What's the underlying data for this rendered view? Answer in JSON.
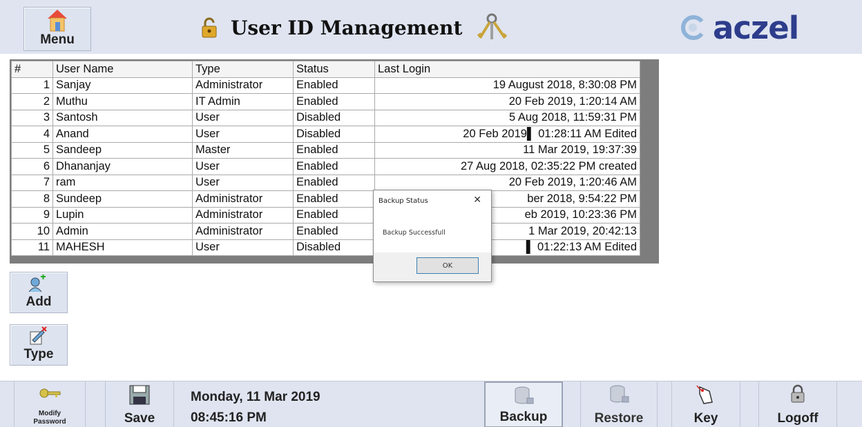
{
  "header": {
    "menu_label": "Menu",
    "title": "User ID Management",
    "brand": "aczel"
  },
  "grid": {
    "columns": [
      "#",
      "User Name",
      "Type",
      "Status",
      "Last Login"
    ],
    "rows": [
      {
        "num": "1",
        "name": "Sanjay",
        "type": "Administrator",
        "status": "Enabled",
        "last": "19 August 2018, 8:30:08 PM"
      },
      {
        "num": "2",
        "name": "Muthu",
        "type": "IT Admin",
        "status": "Enabled",
        "last": "20 Feb 2019, 1:20:14 AM"
      },
      {
        "num": "3",
        "name": "Santosh",
        "type": "User",
        "status": "Disabled",
        "last": "5 Aug 2018, 11:59:31 PM"
      },
      {
        "num": "4",
        "name": "Anand",
        "type": "User",
        "status": "Disabled",
        "last": "20 Feb 2019▌ 01:28:11 AM Edited"
      },
      {
        "num": "5",
        "name": "Sandeep",
        "type": "Master",
        "status": "Enabled",
        "last": "11 Mar 2019, 19:37:39"
      },
      {
        "num": "6",
        "name": "Dhananjay",
        "type": "User",
        "status": "Enabled",
        "last": "27 Aug 2018, 02:35:22 PM created"
      },
      {
        "num": "7",
        "name": "ram",
        "type": "User",
        "status": "Enabled",
        "last": "20 Feb 2019, 1:20:46 AM"
      },
      {
        "num": "8",
        "name": "Sundeep",
        "type": "Administrator",
        "status": "Enabled",
        "last": "ber 2018, 9:54:22 PM"
      },
      {
        "num": "9",
        "name": "Lupin",
        "type": "Administrator",
        "status": "Enabled",
        "last": "eb 2019, 10:23:36 PM"
      },
      {
        "num": "10",
        "name": "Admin",
        "type": "Administrator",
        "status": "Enabled",
        "last": "1 Mar 2019, 20:42:13"
      },
      {
        "num": "11",
        "name": "MAHESH",
        "type": "User",
        "status": "Disabled",
        "last": "▌ 01:22:13 AM Edited"
      }
    ]
  },
  "dialog": {
    "title": "Backup Status",
    "close": "✕",
    "message": "Backup Successfull",
    "ok_label": "OK"
  },
  "side_buttons": {
    "add_label": "Add",
    "type_label": "Type"
  },
  "bottom": {
    "modify_password_label_1": "Modify",
    "modify_password_label_2": "Password",
    "save_label": "Save",
    "date": "Monday, 11 Mar 2019",
    "time": "08:45:16 PM",
    "backup_label": "Backup",
    "restore_label": "Restore",
    "key_label": "Key",
    "logoff_label": "Logoff"
  },
  "colors": {
    "header_bg": "#dfe4f0",
    "brand": "#2d3d8c",
    "grid_frame": "#7d7d7d"
  }
}
